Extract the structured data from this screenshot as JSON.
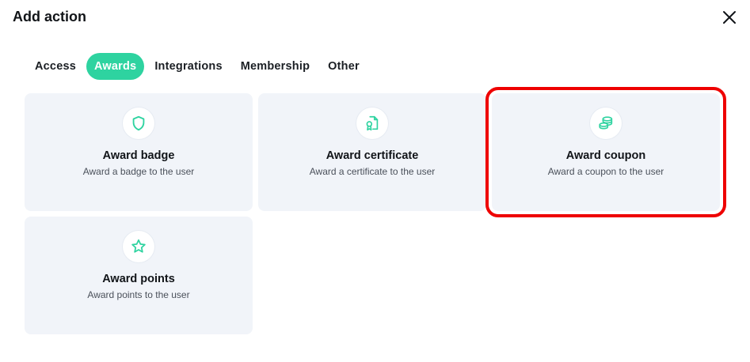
{
  "dialog": {
    "title": "Add action"
  },
  "tabs": [
    {
      "label": "Access",
      "active": false
    },
    {
      "label": "Awards",
      "active": true
    },
    {
      "label": "Integrations",
      "active": false
    },
    {
      "label": "Membership",
      "active": false
    },
    {
      "label": "Other",
      "active": false
    }
  ],
  "cards": [
    {
      "title": "Award badge",
      "description": "Award a badge to the user",
      "icon": "shield-icon"
    },
    {
      "title": "Award certificate",
      "description": "Award a certificate to the user",
      "icon": "certificate-icon"
    },
    {
      "title": "Award coupon",
      "description": "Award a coupon to the user",
      "icon": "coins-icon",
      "highlighted": true
    },
    {
      "title": "Award points",
      "description": "Award points to the user",
      "icon": "star-icon"
    }
  ],
  "colors": {
    "accent": "#2ed3a0",
    "card_bg": "#f1f4f9",
    "highlight": "#ee0000"
  }
}
